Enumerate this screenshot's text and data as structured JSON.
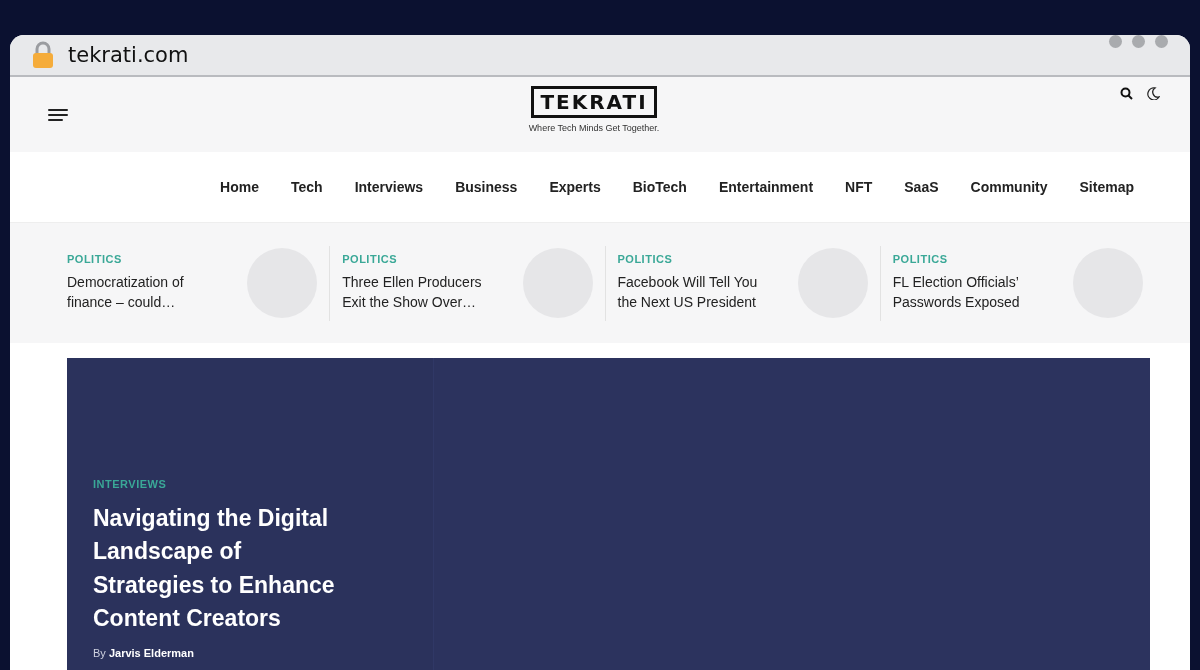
{
  "browser": {
    "url": "tekrati.com"
  },
  "header": {
    "logo": "TEKRATI",
    "tagline": "Where Tech Minds Get Together."
  },
  "nav": [
    "Home",
    "Tech",
    "Interviews",
    "Business",
    "Experts",
    "BioTech",
    "Entertainment",
    "NFT",
    "SaaS",
    "Community",
    "Sitemap"
  ],
  "trending": [
    {
      "category": "POLITICS",
      "title": "Democratization of finance – could…"
    },
    {
      "category": "POLITICS",
      "title": "Three Ellen Producers Exit the Show Over…"
    },
    {
      "category": "POLITICS",
      "title": "Facebook Will Tell You the Next US President"
    },
    {
      "category": "POLITICS",
      "title": "FL Election Officials’ Passwords Exposed"
    }
  ],
  "hero": {
    "category": "INTERVIEWS",
    "title": "Navigating the Digital Landscape of Strategies to Enhance Content Creators",
    "byline": "By **Jarvis Elderman**"
  }
}
